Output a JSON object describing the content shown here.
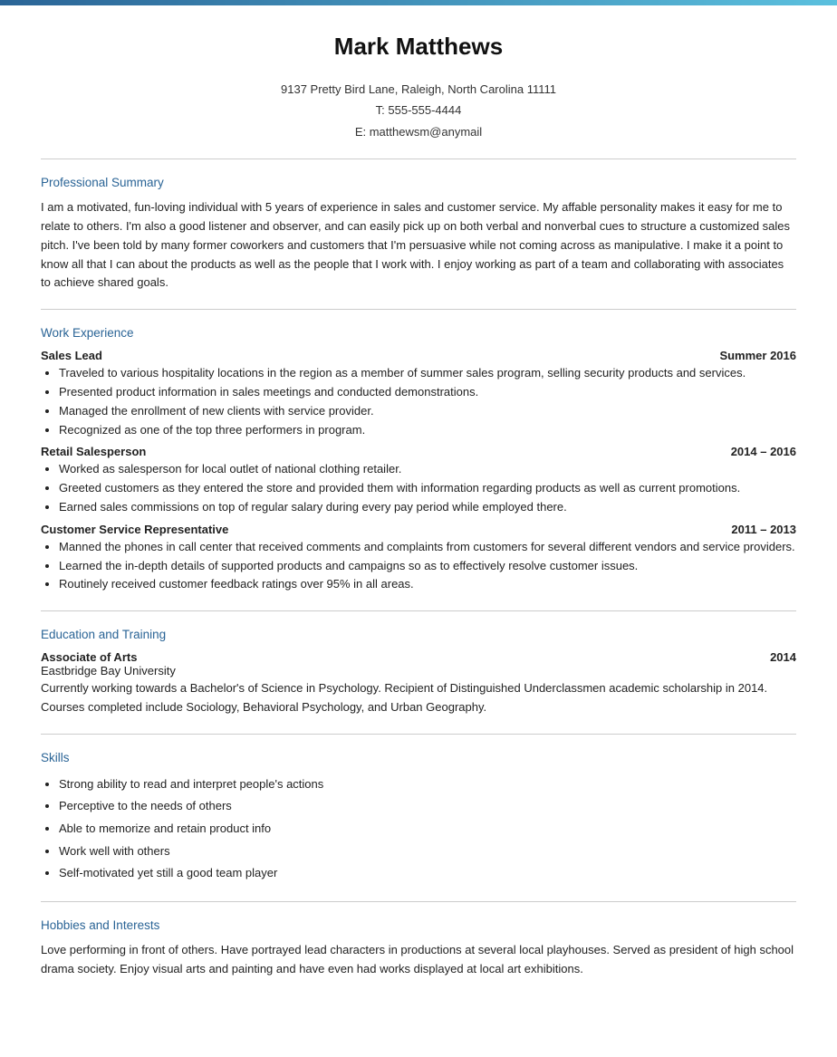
{
  "topBar": {
    "colorLeft": "#2a6496",
    "colorRight": "#5bc0de"
  },
  "header": {
    "name": "Mark Matthews",
    "address": "9137 Pretty Bird Lane, Raleigh, North Carolina 11111",
    "phone": "T: 555-555-4444",
    "email": "E: matthewsm@anymail"
  },
  "sections": {
    "professionalSummary": {
      "title": "Professional Summary",
      "body": "I am a motivated, fun-loving individual with 5 years of experience in sales and customer service. My affable personality makes it easy for me to relate to others. I'm also a good listener and observer, and can easily pick up on both verbal and nonverbal cues to structure a customized sales pitch. I've been told by many former coworkers and customers that I'm persuasive while not coming across as manipulative. I make it a point to know all that I can about the products as well as the people that I work with. I enjoy working as part of a team and collaborating with associates to achieve shared goals."
    },
    "workExperience": {
      "title": "Work Experience",
      "jobs": [
        {
          "title": "Sales Lead",
          "date": "Summer 2016",
          "bullets": [
            "Traveled to various hospitality locations in the region as a member of summer sales program, selling security products and services.",
            "Presented product information in sales meetings and conducted demonstrations.",
            "Managed the enrollment of new clients with service provider.",
            "Recognized as one of the top three performers in program."
          ]
        },
        {
          "title": "Retail Salesperson",
          "date": "2014 – 2016",
          "bullets": [
            "Worked as salesperson for local outlet of national clothing retailer.",
            "Greeted customers as they entered the store and provided them with information regarding products as well as current promotions.",
            "Earned sales commissions on top of regular salary during every pay period while employed there."
          ]
        },
        {
          "title": "Customer Service Representative",
          "date": "2011 – 2013",
          "bullets": [
            "Manned the phones in call center that received comments and complaints from customers for several different vendors and service providers.",
            "Learned the in-depth details of supported products and campaigns so as to effectively resolve customer issues.",
            "Routinely received customer feedback ratings over 95% in all areas."
          ]
        }
      ]
    },
    "education": {
      "title": "Education and Training",
      "entries": [
        {
          "degree": "Associate of Arts",
          "year": "2014",
          "school": "Eastbridge Bay University",
          "description": "Currently working towards a Bachelor's of Science in Psychology. Recipient of Distinguished Underclassmen academic scholarship in 2014. Courses completed include Sociology, Behavioral Psychology, and Urban Geography."
        }
      ]
    },
    "skills": {
      "title": "Skills",
      "items": [
        "Strong ability to read and interpret people's actions",
        "Perceptive to the needs of others",
        "Able to memorize and retain product info",
        "Work well with others",
        "Self-motivated yet still a good team player"
      ]
    },
    "hobbies": {
      "title": "Hobbies and Interests",
      "body": "Love performing in front of others. Have portrayed lead characters in productions at several local playhouses. Served as president of high school drama society. Enjoy visual arts and painting and have even had works displayed at local art exhibitions."
    }
  }
}
